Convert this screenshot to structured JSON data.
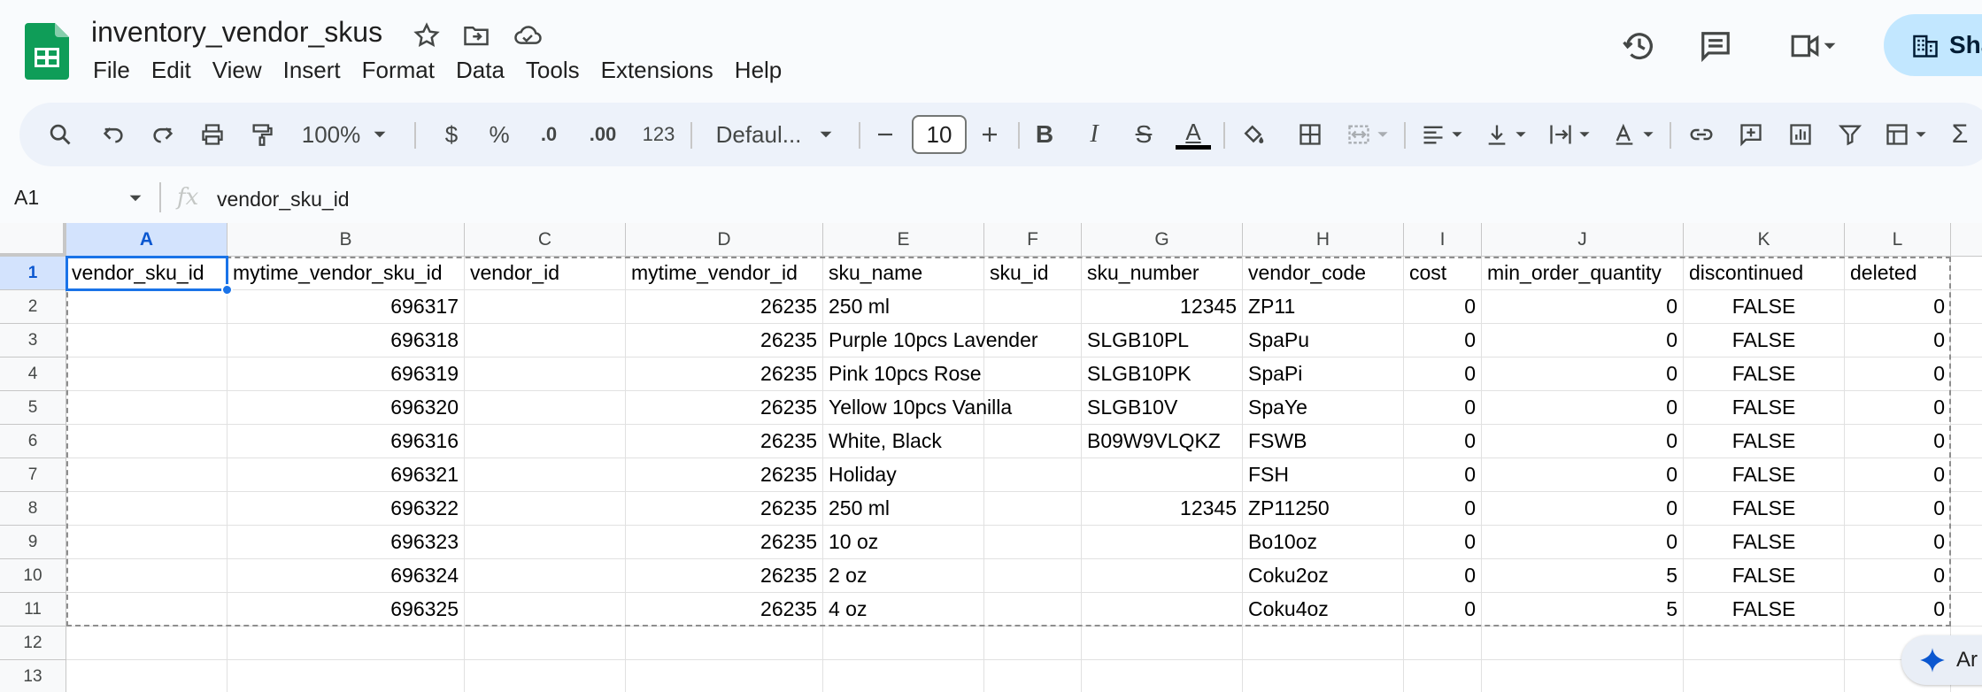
{
  "doc": {
    "title": "inventory_vendor_skus"
  },
  "menu": [
    "File",
    "Edit",
    "View",
    "Insert",
    "Format",
    "Data",
    "Tools",
    "Extensions",
    "Help"
  ],
  "share": {
    "label": "Sha"
  },
  "toolbar": {
    "zoom": "100%",
    "currency": "$",
    "percent": "%",
    "decrease_decimal": ".0",
    "increase_decimal": ".00",
    "number_format": "123",
    "font": "Defaul...",
    "font_size": "10",
    "bold": "B",
    "italic": "I",
    "strikethrough": "S",
    "text_color": "A"
  },
  "formula_bar": {
    "cell_ref": "A1",
    "fx": "fx",
    "content": "vendor_sku_id"
  },
  "ai": {
    "label": "Ar"
  },
  "colors": {
    "accent": "#1a73e8",
    "share_bg": "#c2e7ff",
    "sheets_green": "#0f9d58"
  },
  "grid": {
    "columns": [
      "A",
      "B",
      "C",
      "D",
      "E",
      "F",
      "G",
      "H",
      "I",
      "J",
      "K",
      "L"
    ],
    "rows": [
      "1",
      "2",
      "3",
      "4",
      "5",
      "6",
      "7",
      "8",
      "9",
      "10",
      "11",
      "12",
      "13"
    ],
    "cells": [
      [
        "vendor_sku_id",
        "mytime_vendor_sku_id",
        "vendor_id",
        "mytime_vendor_id",
        "sku_name",
        "sku_id",
        "sku_number",
        "vendor_code",
        "cost",
        "min_order_quantity",
        "discontinued",
        "deleted"
      ],
      [
        "",
        "696317",
        "",
        "26235",
        "250 ml",
        "",
        "12345",
        "ZP11",
        "0",
        "0",
        "FALSE",
        "0"
      ],
      [
        "",
        "696318",
        "",
        "26235",
        "Purple 10pcs Lavender",
        "",
        "SLGB10PL",
        "SpaPu",
        "0",
        "0",
        "FALSE",
        "0"
      ],
      [
        "",
        "696319",
        "",
        "26235",
        "Pink 10pcs Rose",
        "",
        "SLGB10PK",
        "SpaPi",
        "0",
        "0",
        "FALSE",
        "0"
      ],
      [
        "",
        "696320",
        "",
        "26235",
        "Yellow 10pcs Vanilla",
        "",
        "SLGB10V",
        "SpaYe",
        "0",
        "0",
        "FALSE",
        "0"
      ],
      [
        "",
        "696316",
        "",
        "26235",
        "White, Black",
        "",
        "B09W9VLQKZ",
        "FSWB",
        "0",
        "0",
        "FALSE",
        "0"
      ],
      [
        "",
        "696321",
        "",
        "26235",
        "Holiday",
        "",
        "",
        "FSH",
        "0",
        "0",
        "FALSE",
        "0"
      ],
      [
        "",
        "696322",
        "",
        "26235",
        "250 ml",
        "",
        "12345",
        "ZP11250",
        "0",
        "0",
        "FALSE",
        "0"
      ],
      [
        "",
        "696323",
        "",
        "26235",
        "10 oz",
        "",
        "",
        "Bo10oz",
        "0",
        "0",
        "FALSE",
        "0"
      ],
      [
        "",
        "696324",
        "",
        "26235",
        "2 oz",
        "",
        "",
        "Coku2oz",
        "0",
        "5",
        "FALSE",
        "0"
      ],
      [
        "",
        "696325",
        "",
        "26235",
        "4 oz",
        "",
        "",
        "Coku4oz",
        "0",
        "5",
        "FALSE",
        "0"
      ],
      [
        "",
        "",
        "",
        "",
        "",
        "",
        "",
        "",
        "",
        "",
        "",
        ""
      ],
      [
        "",
        "",
        "",
        "",
        "",
        "",
        "",
        "",
        "",
        "",
        "",
        ""
      ]
    ]
  }
}
